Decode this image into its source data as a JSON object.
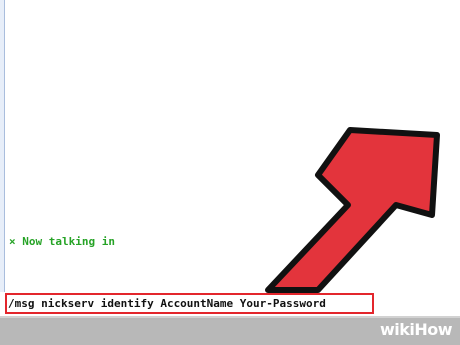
{
  "chat": {
    "status_line": "× Now talking in"
  },
  "input": {
    "command_text": "/msg nickserv identify AccountName Your-Password"
  },
  "watermark": {
    "part1": "wiki",
    "part2": "How"
  },
  "colors": {
    "arrow_fill": "#e3343c",
    "highlight_border": "#e3262c",
    "status_text": "#26a326"
  }
}
